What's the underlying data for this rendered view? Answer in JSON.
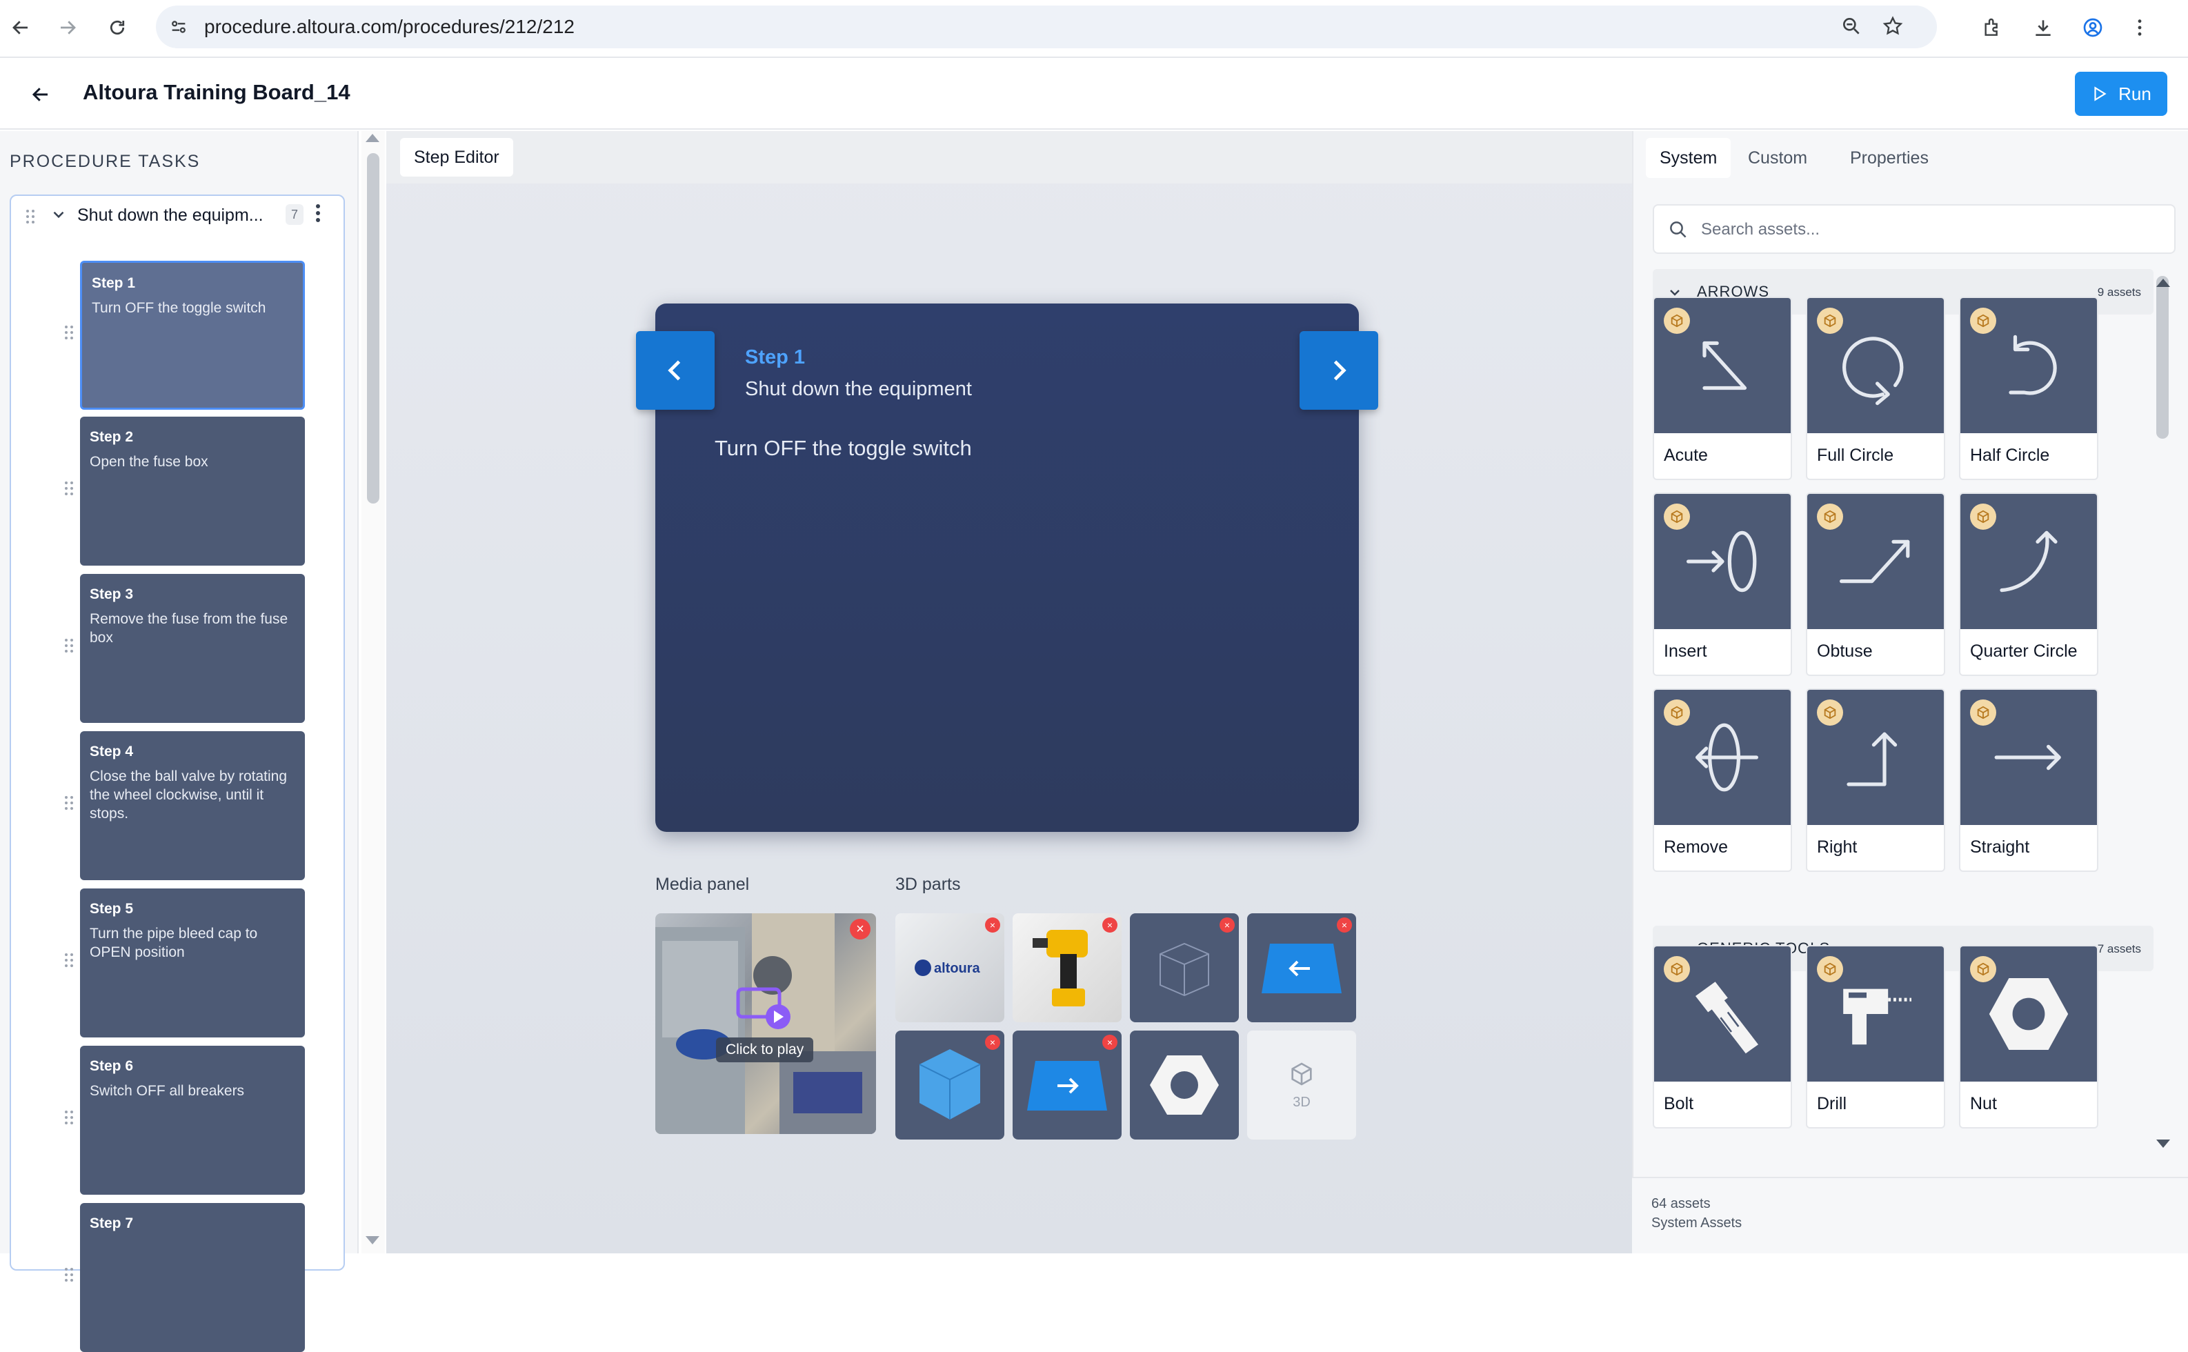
{
  "browser": {
    "url": "procedure.altoura.com/procedures/212/212"
  },
  "header": {
    "title": "Altoura Training Board_14",
    "run_label": "Run"
  },
  "left_panel": {
    "heading": "PROCEDURE TASKS",
    "task": {
      "name": "Shut down the equipm...",
      "count": "7"
    },
    "steps": [
      {
        "num": "Step 1",
        "text": "Turn OFF the toggle switch"
      },
      {
        "num": "Step 2",
        "text": "Open the fuse box"
      },
      {
        "num": "Step 3",
        "text": "Remove the fuse from the fuse box"
      },
      {
        "num": "Step 4",
        "text": "Close the ball valve by rotating the wheel clockwise, until it stops."
      },
      {
        "num": "Step 5",
        "text": "Turn the pipe bleed cap to OPEN position"
      },
      {
        "num": "Step 6",
        "text": "Switch OFF all breakers"
      },
      {
        "num": "Step 7",
        "text": ""
      }
    ]
  },
  "editor": {
    "tab_label": "Step Editor",
    "step_panel": {
      "step_label": "Step 1",
      "task_title": "Shut down the equipment",
      "instruction": "Turn OFF the toggle switch"
    },
    "media_label": "Media panel",
    "media_hint": "Click to play",
    "parts_label": "3D parts",
    "parts_placeholder": "3D"
  },
  "right_panel": {
    "tabs": [
      "System",
      "Custom",
      "Properties"
    ],
    "search_placeholder": "Search assets...",
    "categories": [
      {
        "name": "ARROWS",
        "count": "9 assets",
        "assets": [
          "Acute",
          "Full Circle",
          "Half Circle",
          "Insert",
          "Obtuse",
          "Quarter Circle",
          "Remove",
          "Right",
          "Straight"
        ]
      },
      {
        "name": "GENERIC TOOLS",
        "count": "7 assets",
        "assets": [
          "Bolt",
          "Drill",
          "Nut"
        ]
      }
    ],
    "footer_count": "64 assets",
    "footer_label": "System Assets"
  },
  "colors": {
    "accent": "#1d8ff0",
    "step_card": "#4d5a75",
    "step_panel": "#2f3f6c",
    "nav_arrow": "#1676d2"
  }
}
